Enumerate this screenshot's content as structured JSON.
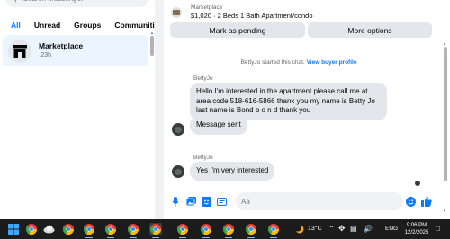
{
  "search": {
    "placeholder": "Search Messenger"
  },
  "filters": [
    {
      "label": "All"
    },
    {
      "label": "Unread"
    },
    {
      "label": "Groups"
    },
    {
      "label": "Communities"
    }
  ],
  "chat_list": [
    {
      "title": "Marketplace",
      "time": "·23h"
    }
  ],
  "listing": {
    "source": "Marketplace",
    "title": "$1,020 · 2 Beds 1 Bath Apartment/condo"
  },
  "actions": {
    "pending": "Mark as pending",
    "more": "More options"
  },
  "system": {
    "started": "BettyJo started this chat.",
    "link": "View buyer profile"
  },
  "messages": [
    {
      "sender": "BettyJo",
      "text": "Hello I'm interested in the apartment please call me at area code 518-616-5866 thank you my name is Betty Jo last name is Bond b o n d thank you"
    },
    {
      "sender": "",
      "text": "Message sent"
    },
    {
      "sender": "BettyJo",
      "text": "Yes I'm very interested"
    }
  ],
  "composer": {
    "placeholder": "Aa"
  },
  "taskbar": {
    "temperature": "13°C",
    "language": "ENG",
    "time": "9:06 PM",
    "date": "12/2/2025"
  },
  "colors": {
    "accent": "#0a7cff",
    "bubble": "#e4e6eb",
    "selected_chat": "#ebf5ff",
    "taskbar": "#1c1c1c"
  }
}
